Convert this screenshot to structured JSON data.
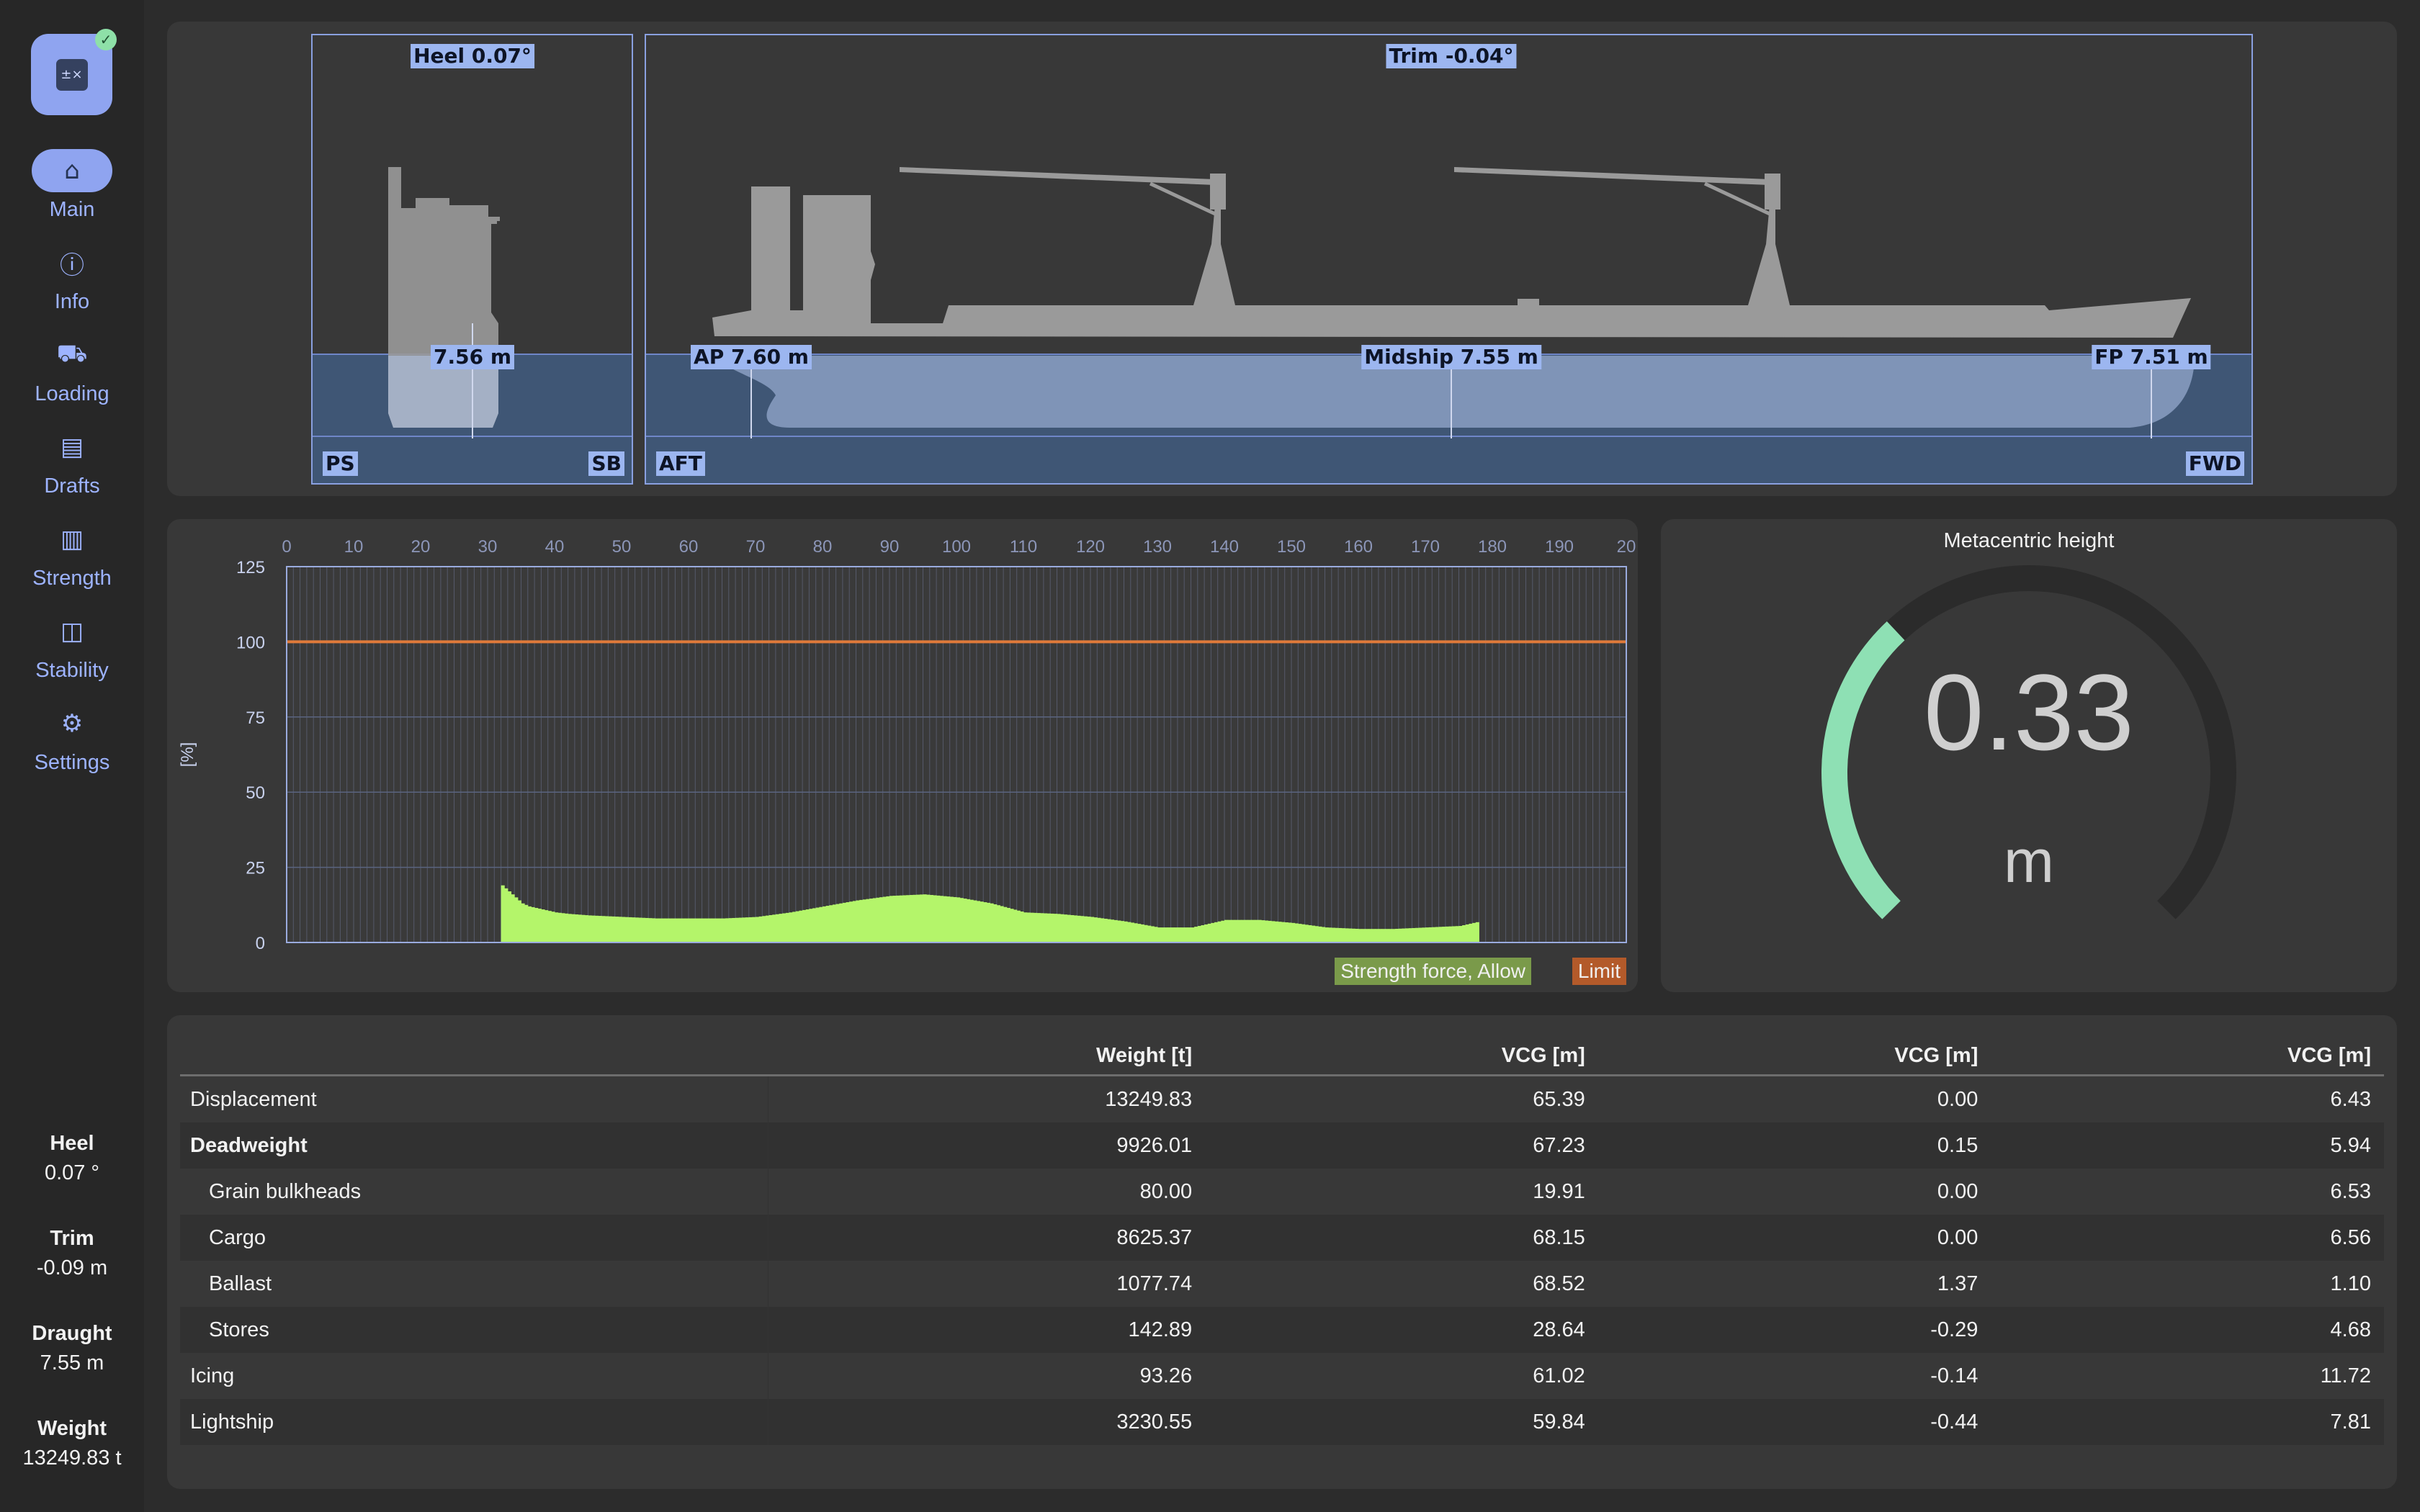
{
  "app": {
    "icon": "calculator-icon",
    "status_icon": "check-icon"
  },
  "nav": [
    {
      "label": "Main",
      "icon": "home-icon",
      "active": true
    },
    {
      "label": "Info",
      "icon": "info-icon"
    },
    {
      "label": "Loading",
      "icon": "loading-icon"
    },
    {
      "label": "Drafts",
      "icon": "ruler-icon"
    },
    {
      "label": "Strength",
      "icon": "bar-chart-icon"
    },
    {
      "label": "Stability",
      "icon": "stability-icon"
    },
    {
      "label": "Settings",
      "icon": "gear-icon"
    }
  ],
  "side_stats": {
    "heel": {
      "label": "Heel",
      "value": "0.07 °"
    },
    "trim": {
      "label": "Trim",
      "value": "-0.09 m"
    },
    "draught": {
      "label": "Draught",
      "value": "7.55 m"
    },
    "weight": {
      "label": "Weight",
      "value": "13249.83 t"
    }
  },
  "ship_view": {
    "heel_label": "Heel 0.07°",
    "trim_label": "Trim -0.04°",
    "midship_draft_small": "7.56 m",
    "ps": "PS",
    "sb": "SB",
    "ap": "AP 7.60 m",
    "midship": "Midship 7.55 m",
    "fp": "FP 7.51 m",
    "aft": "AFT",
    "fwd": "FWD"
  },
  "chart_data": {
    "type": "bar",
    "x_ticks": [
      0,
      10,
      20,
      30,
      40,
      50,
      60,
      70,
      80,
      90,
      100,
      110,
      120,
      130,
      140,
      150,
      160,
      170,
      180,
      190,
      20
    ],
    "xlim": [
      0,
      200
    ],
    "ylim": [
      0,
      125
    ],
    "y_ticks": [
      0,
      25,
      50,
      75,
      100,
      125
    ],
    "ylabel": "[%]",
    "limit": 100,
    "series": [
      {
        "name": "Strength force, Allow",
        "color": "#b4f56a",
        "x": [
          32,
          33,
          34,
          35,
          36,
          38,
          40,
          42,
          45,
          50,
          55,
          60,
          65,
          70,
          75,
          80,
          85,
          90,
          95,
          100,
          105,
          110,
          115,
          120,
          125,
          130,
          135,
          140,
          145,
          150,
          155,
          160,
          165,
          170,
          175,
          178
        ],
        "values": [
          19,
          17,
          15,
          13,
          12,
          11,
          10,
          9.5,
          9,
          8.5,
          8,
          8,
          8,
          8.5,
          10,
          12,
          14,
          15.5,
          16,
          15,
          13,
          10,
          9.5,
          8.5,
          7,
          5,
          5,
          7.5,
          7.5,
          6.5,
          5,
          4.5,
          4.5,
          5,
          5.5,
          7
        ]
      }
    ],
    "legend": [
      {
        "label": "Strength force, Allow",
        "color": "#7a9a4a"
      },
      {
        "label": "Limit",
        "color": "#b35a2a"
      }
    ]
  },
  "gauge": {
    "title": "Metacentric height",
    "value": "0.33",
    "unit": "m",
    "fraction": 0.34,
    "color": "#8ee0b4"
  },
  "table": {
    "headers": [
      "",
      "Weight [t]",
      "VCG [m]",
      "VCG [m]",
      "VCG [m]"
    ],
    "rows": [
      {
        "name": "Displacement",
        "style": "normal",
        "cells": [
          "13249.83",
          "65.39",
          "0.00",
          "6.43"
        ]
      },
      {
        "name": "Deadweight",
        "style": "bold",
        "cells": [
          "9926.01",
          "67.23",
          "0.15",
          "5.94"
        ]
      },
      {
        "name": "Grain bulkheads",
        "style": "sub",
        "cells": [
          "80.00",
          "19.91",
          "0.00",
          "6.53"
        ]
      },
      {
        "name": "Cargo",
        "style": "sub",
        "cells": [
          "8625.37",
          "68.15",
          "0.00",
          "6.56"
        ]
      },
      {
        "name": "Ballast",
        "style": "sub",
        "cells": [
          "1077.74",
          "68.52",
          "1.37",
          "1.10"
        ]
      },
      {
        "name": "Stores",
        "style": "sub",
        "cells": [
          "142.89",
          "28.64",
          "-0.29",
          "4.68"
        ]
      },
      {
        "name": "Icing",
        "style": "normal",
        "cells": [
          "93.26",
          "61.02",
          "-0.14",
          "11.72"
        ]
      },
      {
        "name": "Lightship",
        "style": "normal",
        "cells": [
          "3230.55",
          "59.84",
          "-0.44",
          "7.81"
        ]
      }
    ]
  }
}
